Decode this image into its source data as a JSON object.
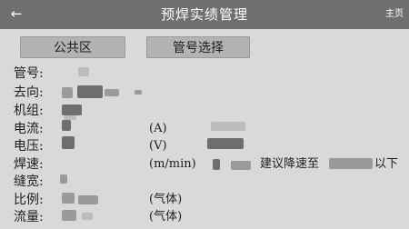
{
  "header": {
    "back_icon": "arrow-left-icon",
    "back_glyph": "←",
    "title": "预焊实绩管理",
    "home_label": "主页"
  },
  "buttons": {
    "public_area": "公共区",
    "pipe_select": "管号选择"
  },
  "fields": {
    "pipe_no": {
      "label": "管号:"
    },
    "direction": {
      "label": "去向:"
    },
    "unit_group": {
      "label": "机组:"
    },
    "current": {
      "label": "电流:",
      "unit": "(A)"
    },
    "voltage": {
      "label": "电压:",
      "unit": "(V)"
    },
    "weld_speed": {
      "label": "焊速:",
      "unit": "(m/min)",
      "advice_prefix": "建议降速至",
      "advice_suffix": "以下"
    },
    "gap_width": {
      "label": "缝宽:"
    },
    "ratio": {
      "label": "比例:",
      "unit": "(气体)"
    },
    "flow": {
      "label": "流量:",
      "unit": "(气体)"
    }
  }
}
